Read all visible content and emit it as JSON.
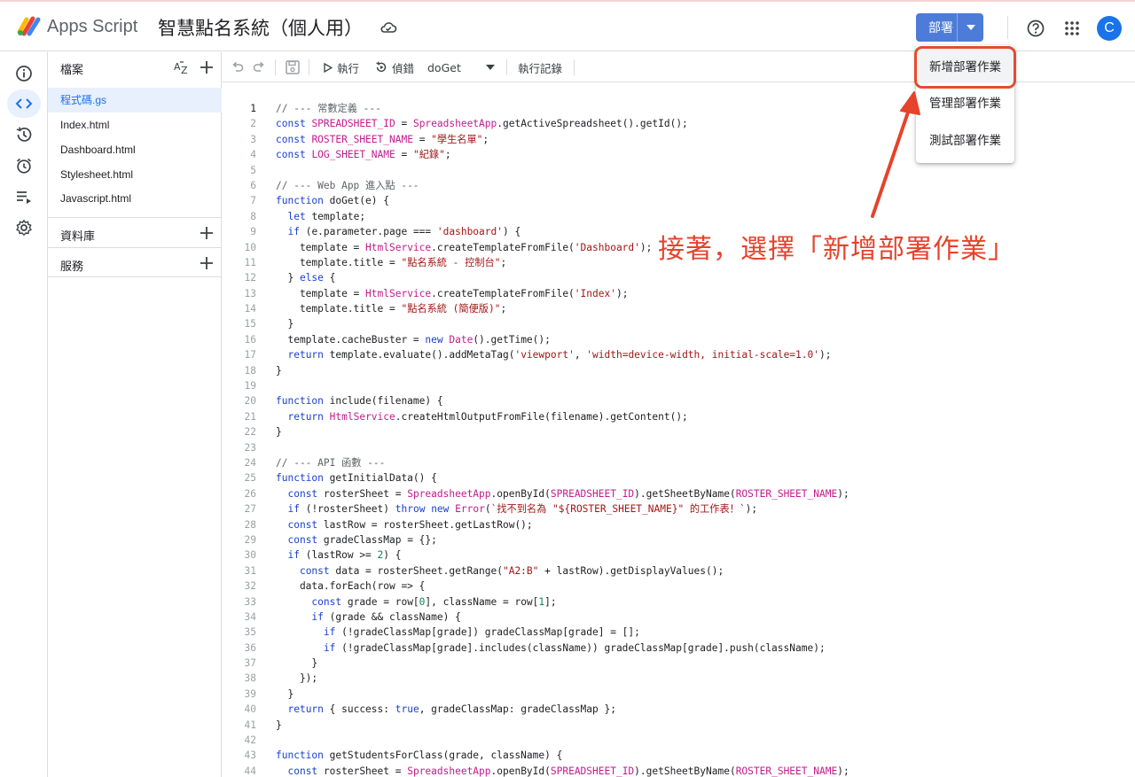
{
  "header": {
    "app_name": "Apps Script",
    "project_title": "智慧點名系統（個人用）",
    "deploy_label": "部署",
    "avatar_initial": "C"
  },
  "rail": {
    "icons": [
      "info-icon",
      "code-icon",
      "history-icon",
      "alarm-icon",
      "executions-icon",
      "settings-icon"
    ],
    "active": "code-icon"
  },
  "files": {
    "title": "檔案",
    "items": [
      "程式碼.gs",
      "Index.html",
      "Dashboard.html",
      "Stylesheet.html",
      "Javascript.html"
    ],
    "active_index": 0,
    "sections": [
      "資料庫",
      "服務"
    ]
  },
  "toolbar": {
    "run_label": "執行",
    "debug_label": "偵錯",
    "function_select": "doGet",
    "log_label": "執行記錄"
  },
  "menu": {
    "items": [
      "新增部署作業",
      "管理部署作業",
      "測試部署作業"
    ],
    "highlighted_index": 0
  },
  "annotation": {
    "text": "接著，選擇「新增部署作業」",
    "color": "#e5432b"
  },
  "editor": {
    "current_line": 1,
    "lines": [
      "// --- 常數定義 ---",
      "const SPREADSHEET_ID = SpreadsheetApp.getActiveSpreadsheet().getId();",
      "const ROSTER_SHEET_NAME = \"學生名單\";",
      "const LOG_SHEET_NAME = \"紀錄\";",
      "",
      "// --- Web App 進入點 ---",
      "function doGet(e) {",
      "  let template;",
      "  if (e.parameter.page === 'dashboard') {",
      "    template = HtmlService.createTemplateFromFile('Dashboard');",
      "    template.title = \"點名系統 - 控制台\";",
      "  } else {",
      "    template = HtmlService.createTemplateFromFile('Index');",
      "    template.title = \"點名系統 (簡便版)\";",
      "  }",
      "  template.cacheBuster = new Date().getTime();",
      "  return template.evaluate().addMetaTag('viewport', 'width=device-width, initial-scale=1.0');",
      "}",
      "",
      "function include(filename) {",
      "  return HtmlService.createHtmlOutputFromFile(filename).getContent();",
      "}",
      "",
      "// --- API 函數 ---",
      "function getInitialData() {",
      "  const rosterSheet = SpreadsheetApp.openById(SPREADSHEET_ID).getSheetByName(ROSTER_SHEET_NAME);",
      "  if (!rosterSheet) throw new Error(`找不到名為 \"${ROSTER_SHEET_NAME}\" 的工作表！`);",
      "  const lastRow = rosterSheet.getLastRow();",
      "  const gradeClassMap = {};",
      "  if (lastRow >= 2) {",
      "    const data = rosterSheet.getRange(\"A2:B\" + lastRow).getDisplayValues();",
      "    data.forEach(row => {",
      "      const grade = row[0], className = row[1];",
      "      if (grade && className) {",
      "        if (!gradeClassMap[grade]) gradeClassMap[grade] = [];",
      "        if (!gradeClassMap[grade].includes(className)) gradeClassMap[grade].push(className);",
      "      }",
      "    });",
      "  }",
      "  return { success: true, gradeClassMap: gradeClassMap };",
      "}",
      "",
      "function getStudentsForClass(grade, className) {",
      "  const rosterSheet = SpreadsheetApp.openById(SPREADSHEET_ID).getSheetByName(ROSTER_SHEET_NAME);"
    ]
  }
}
